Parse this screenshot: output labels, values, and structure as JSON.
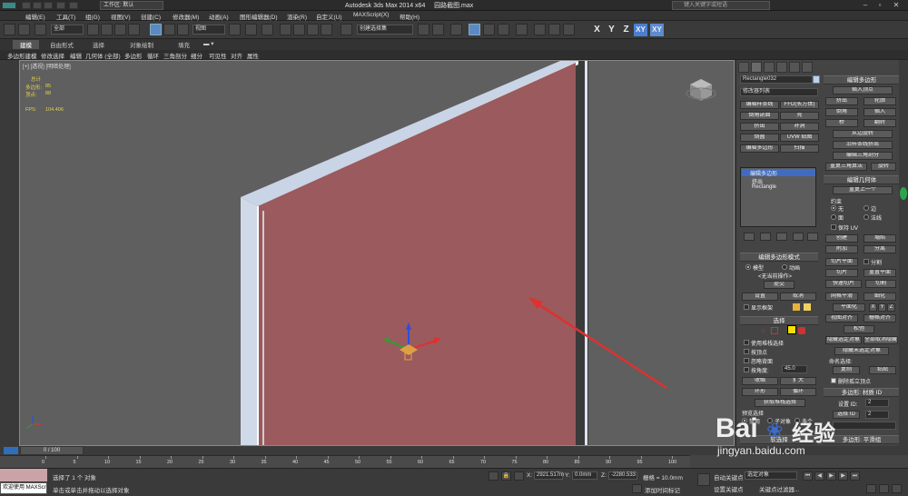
{
  "window": {
    "title": "Autodesk 3ds Max  2014 x64",
    "filename": "园路截图.max",
    "workspace": "工作区: 默认",
    "search_placeholder": "键入关键字或短语"
  },
  "menu": [
    "编辑(E)",
    "工具(T)",
    "组(G)",
    "视图(V)",
    "创建(C)",
    "修改器(M)",
    "动画(A)",
    "图形编辑器(D)",
    "渲染(R)",
    "自定义(U)",
    "MAXScript(X)",
    "帮助(H)"
  ],
  "toolbar": {
    "selection_filter": "全部",
    "ref_coord": "视图",
    "named_selection": "创建选择集",
    "axes": [
      "X",
      "Y",
      "Z",
      "XY",
      "XY"
    ]
  },
  "ribbon": {
    "tabs": [
      "建模",
      "自由形式",
      "选择",
      "对象绘制",
      "填充"
    ],
    "items": [
      "多边形建模",
      "修改选择",
      "编辑",
      "几何体 (全部)",
      "多边形",
      "循环",
      "三角剖分",
      "细分",
      "可见性",
      "对齐",
      "属性"
    ]
  },
  "viewport": {
    "label": "[+] [透视] [明暗处理]",
    "stats": {
      "total_label": "总计",
      "polys_label": "多边形:",
      "polys_value": "85",
      "verts_label": "顶点:",
      "verts_value": "88",
      "fps_label": "FPS:",
      "fps_value": "104.406"
    },
    "colors": {
      "wall": "#9a5a5e",
      "trim": "#c7d3e3",
      "background": "#5f5f5f"
    }
  },
  "cmdpanel": {
    "object_name": "Rectangle032",
    "modifier_list": "修改器列表",
    "modifier_buttons": [
      "编辑样条线",
      "FFD(长方体)",
      "倒角剖面",
      "壳",
      "挤出",
      "补洞",
      "倒圆",
      "UVW 贴图",
      "编辑多边形",
      "扫描"
    ],
    "stack": [
      "编辑多边形",
      "挤出",
      "Rectangle"
    ],
    "edit_poly_mode": {
      "header": "编辑多边形模式",
      "model": "模型",
      "animate": "动画",
      "no_op": "<无当前操作>",
      "commit": "提交",
      "settings": "设置",
      "cancel": "取消",
      "show_cage": "显示框架"
    },
    "selection": {
      "header": "选择",
      "by_vertex": "使用堆栈选择",
      "by_vert": "按顶点",
      "ignore_back": "忽略背面",
      "by_angle": "按角度:",
      "angle_value": "45.0",
      "shrink": "收缩",
      "grow": "扩大",
      "ring": "环形",
      "loop": "循环",
      "get_stack": "获取堆栈选择",
      "preview": "预览选择",
      "off": "禁用",
      "subobj": "子对象",
      "multi": "多个"
    },
    "soft_selection": "软选择",
    "right_col": {
      "edit_poly": "编辑多边形",
      "insert_vertex": "插入顶点",
      "extrude": "挤出",
      "outline": "轮廓",
      "bevel": "倒角",
      "inset": "插入",
      "bridge": "桥",
      "flip": "翻转",
      "hinge": "从边旋转",
      "spline": "沿样条线挤出",
      "edit_tri": "编辑三角剖分",
      "retri": "重复三角算法",
      "turn": "旋转",
      "edit_geo": "编辑几何体",
      "repeat": "重复上一个",
      "constraints": "约束",
      "none": "无",
      "edge": "边",
      "face": "面",
      "normal": "法线",
      "preserve_uv": "保持 UV",
      "create": "创建",
      "collapse": "塌陷",
      "attach": "附加",
      "detach": "分离",
      "slice_plane": "切片平面",
      "split": "分割",
      "slice": "切片",
      "reset_plane": "重置平面",
      "quickslice": "快速切片",
      "cut": "切割",
      "meshsmooth": "网格平滑",
      "tessellate": "细化",
      "make_planar": "平面化",
      "x": "X",
      "y": "Y",
      "z": "Z",
      "view_align": "视图对齐",
      "grid_align": "栅格对齐",
      "relax": "松弛",
      "hide_sel": "隐藏选定对象",
      "unhide_all": "全部取消隐藏",
      "hide_unsel": "隐藏未选定对象",
      "named_sel": "命名选择:",
      "copy": "复制",
      "paste": "粘贴",
      "delete_iso": "删除孤立顶点",
      "poly_mat": "多边形: 材质 ID",
      "set_id": "设置 ID:",
      "set_id_val": "2",
      "select_id": "选择 ID",
      "select_id_val": "2",
      "smooth_group": "多边形: 平滑组"
    }
  },
  "timeline": {
    "frame": "0 / 100",
    "ticks": [
      "0",
      "5",
      "10",
      "15",
      "20",
      "25",
      "30",
      "35",
      "40",
      "45",
      "50",
      "55",
      "60",
      "65",
      "70",
      "75",
      "80",
      "85",
      "90",
      "95",
      "100"
    ]
  },
  "status": {
    "welcome": "欢迎使用 MAXScr",
    "selected": "选择了 1 个 对象",
    "hint": "单击或单击并拖动以选择对象",
    "x_label": "X:",
    "x_value": "2921.517m",
    "y_label": "Y:",
    "y_value": "0.0mm",
    "z_label": "Z:",
    "z_value": "-2280.533",
    "grid": "栅格 = 10.0mm",
    "add_time_tag": "添加时间标记",
    "auto_key": "自动关键点",
    "selected_obj": "选定对象",
    "set_key": "设置关键点",
    "key_filters": "关键点过滤器..."
  },
  "watermark": {
    "brand": "Bai",
    "brand_cn": "经验",
    "url": "jingyan.baidu.com"
  }
}
